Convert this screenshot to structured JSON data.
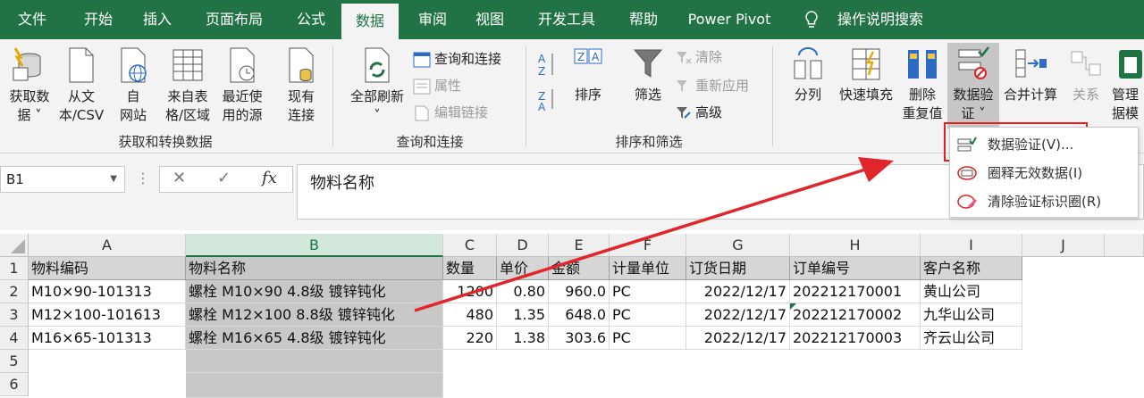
{
  "tabs": [
    "文件",
    "开始",
    "插入",
    "页面布局",
    "公式",
    "数据",
    "审阅",
    "视图",
    "开发工具",
    "帮助",
    "Power Pivot",
    "操作说明搜索"
  ],
  "ribbon": {
    "get_data": "获取数\n据 ˅",
    "from_csv": "从文\n本/CSV",
    "from_web": "自\n网站",
    "from_table": "来自表\n格/区域",
    "recent_sources": "最近使\n用的源",
    "existing_conn": "现有\n连接",
    "group1_label": "获取和转换数据",
    "refresh_all": "全部刷新\n˅",
    "queries_conn": "查询和连接",
    "properties": "属性",
    "edit_links": "编辑链接",
    "group2_label": "查询和连接",
    "sort_az": "A→Z",
    "sort": "排序",
    "filter": "筛选",
    "clear": "清除",
    "reapply": "重新应用",
    "advanced": "高级",
    "group3_label": "排序和筛选",
    "text_to_columns": "分列",
    "flash_fill": "快速填充",
    "remove_dup": "删除\n重复值",
    "data_validation": "数据验\n证 ˅",
    "consolidate": "合并计算",
    "relationships": "关系",
    "manage_model": "管理\n据模"
  },
  "menu": {
    "item1": "数据验证(V)...",
    "item2": "圈释无效数据(I)",
    "item3": "清除验证标识圈(R)"
  },
  "formula_bar": {
    "name_box": "B1",
    "cancel": "✕",
    "enter": "✓",
    "fx": "fx",
    "content": "物料名称"
  },
  "columns": [
    "A",
    "B",
    "C",
    "D",
    "E",
    "F",
    "G",
    "H",
    "I",
    "J"
  ],
  "rows": [
    "1",
    "2",
    "3",
    "4",
    "5",
    "6"
  ],
  "table": {
    "header": [
      "物料编码",
      "物料名称",
      "数量",
      "单价",
      "金额",
      "计量单位",
      "订货日期",
      "订单编号",
      "客户名称"
    ],
    "r2": [
      "M10×90-101313",
      "螺栓 M10×90  4.8级 镀锌钝化",
      "1200",
      "0.80",
      "960.0",
      "PC",
      "2022/12/17",
      "202212170001",
      "黄山公司"
    ],
    "r3": [
      "M12×100-101613",
      "螺栓 M12×100  8.8级 镀锌钝化",
      "480",
      "1.35",
      "648.0",
      "PC",
      "2022/12/17",
      "202212170002",
      "九华山公司"
    ],
    "r4": [
      "M16×65-101313",
      "螺栓 M16×65  4.8级 镀锌钝化",
      "220",
      "1.38",
      "303.6",
      "PC",
      "2022/12/17",
      "202212170003",
      "齐云山公司"
    ]
  },
  "colors": {
    "excel_green": "#217346",
    "highlight_red": "#e02020",
    "arrow_red": "#e0262a"
  }
}
